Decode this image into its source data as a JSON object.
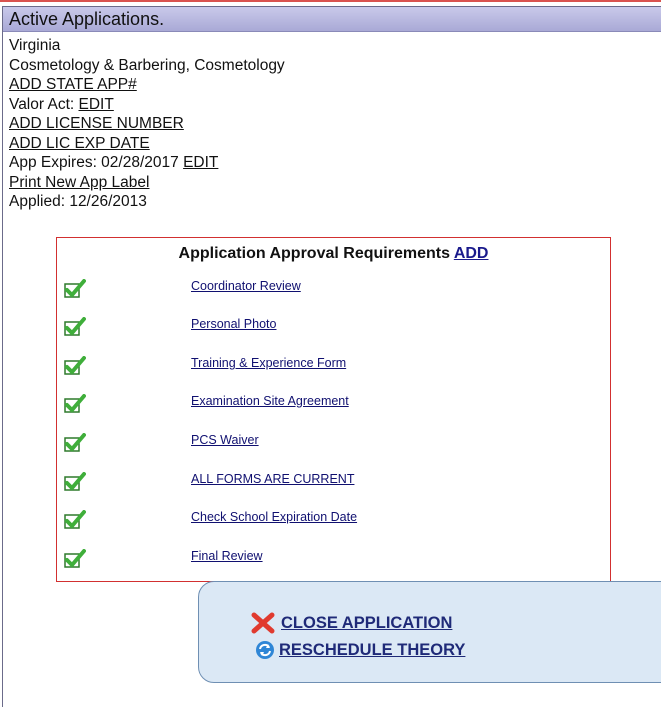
{
  "panel": {
    "title": "Active Applications.",
    "state": "Virginia",
    "board": "Cosmetology & Barbering, Cosmetology",
    "add_state_app": "ADD STATE APP#",
    "valor_label": "Valor Act: ",
    "valor_edit": "EDIT",
    "add_license_number": "ADD LICENSE NUMBER",
    "add_lic_exp_date": "ADD LIC EXP DATE",
    "app_expires_label": "App Expires: 02/28/2017 ",
    "app_expires_edit": "EDIT",
    "print_label": "Print New App Label",
    "applied": "Applied: 12/26/2013"
  },
  "requirements": {
    "title": "Application Approval Requirements ",
    "add_label": "ADD",
    "items": [
      {
        "label": "Coordinator Review",
        "icon": "check-icon",
        "complete": true
      },
      {
        "label": "Personal Photo",
        "icon": "check-icon",
        "complete": true
      },
      {
        "label": "Training & Experience Form",
        "icon": "check-icon",
        "complete": true
      },
      {
        "label": "Examination Site Agreement",
        "icon": "check-icon",
        "complete": true
      },
      {
        "label": "PCS Waiver",
        "icon": "check-icon",
        "complete": true
      },
      {
        "label": "ALL FORMS ARE CURRENT",
        "icon": "check-icon",
        "complete": true
      },
      {
        "label": "Check School Expiration Date",
        "icon": "check-icon",
        "complete": true
      },
      {
        "label": "Final Review",
        "icon": "check-icon",
        "complete": true
      }
    ]
  },
  "actions": {
    "close_label": "CLOSE APPLICATION",
    "close_icon": "red-x-icon",
    "reschedule_label": "RESCHEDULE THEORY",
    "reschedule_icon": "refresh-icon"
  },
  "colors": {
    "header_bg": "#b9b9e2",
    "box_border": "#d23030",
    "check_green": "#3fae3a",
    "action_bg": "#dbe8f5",
    "close_red": "#e03a2f"
  }
}
